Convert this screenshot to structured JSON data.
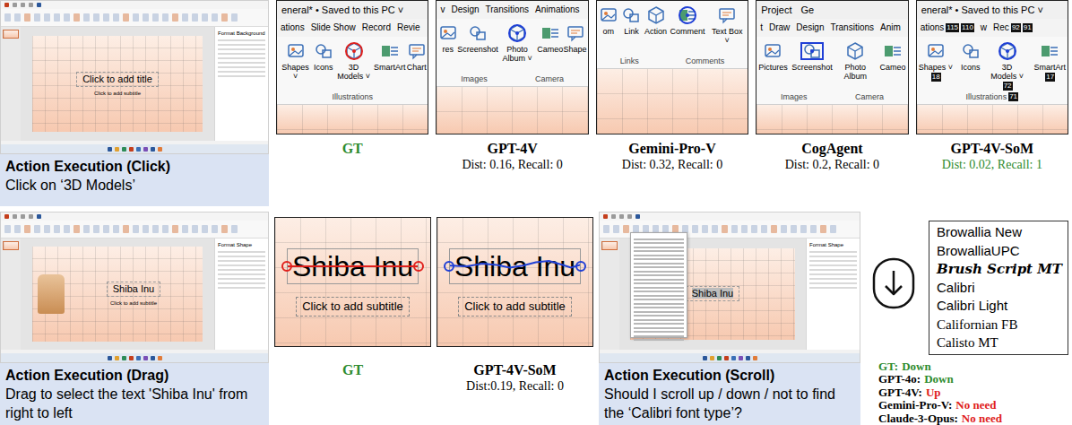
{
  "click_example": {
    "screenshot": {
      "slide_title": "Click to add title",
      "slide_subtitle": "Click to add subtitle",
      "pane_title": "Format Background"
    },
    "caption": {
      "title": "Action Execution (Click)",
      "instruction": "Click on ‘3D Models’"
    },
    "crops": [
      {
        "model": "GT",
        "reference": true,
        "titlebar": [
          "eneral* • Saved to this PC ˅"
        ],
        "tabs": [
          {
            "label": "ations",
            "tags": []
          },
          {
            "label": "Slide Show",
            "tags": []
          },
          {
            "label": "Record",
            "tags": []
          },
          {
            "label": "Revie",
            "tags": []
          }
        ],
        "items": [
          {
            "label": "Shapes ˅",
            "tags": [],
            "clicked": false
          },
          {
            "label": "Icons",
            "tags": [],
            "clicked": false
          },
          {
            "label": "3D Models ˅",
            "tags": [],
            "clicked": true
          },
          {
            "label": "SmartArt",
            "tags": [],
            "clicked": false
          },
          {
            "label": "Chart",
            "tags": [],
            "clicked": false
          }
        ],
        "groups": [
          {
            "label": "Illustrations",
            "tags": []
          }
        ],
        "marker": {
          "kind": "circle",
          "color": "#e0201c"
        }
      },
      {
        "model": "GPT-4V",
        "reference": false,
        "score": "Dist: 0.16, Recall: 0",
        "correct": false,
        "titlebar": [],
        "tabs": [
          {
            "label": "v",
            "tags": []
          },
          {
            "label": "Design",
            "tags": []
          },
          {
            "label": "Transitions",
            "tags": []
          },
          {
            "label": "Animations",
            "tags": []
          }
        ],
        "items": [
          {
            "label": "res",
            "tags": [],
            "clicked": false
          },
          {
            "label": "Screenshot",
            "tags": [],
            "clicked": false
          },
          {
            "label": "Photo Album ˅",
            "tags": [],
            "clicked": true
          },
          {
            "label": "Cameo",
            "tags": [],
            "clicked": false
          },
          {
            "label": "Shape",
            "tags": [],
            "clicked": false
          }
        ],
        "groups": [
          {
            "label": "Images",
            "tags": []
          },
          {
            "label": "Camera",
            "tags": []
          }
        ],
        "marker": {
          "kind": "circle",
          "color": "#1f3fd6"
        }
      },
      {
        "model": "Gemini-Pro-V",
        "reference": false,
        "score": "Dist: 0.32, Recall: 0",
        "correct": false,
        "titlebar": [],
        "tabs": [],
        "items": [
          {
            "label": "om",
            "tags": [],
            "clicked": false
          },
          {
            "label": "Link",
            "tags": [],
            "clicked": false
          },
          {
            "label": "Action",
            "tags": [],
            "clicked": false
          },
          {
            "label": "Comment",
            "tags": [],
            "clicked": true
          },
          {
            "label": "Text Box ˅",
            "tags": [],
            "clicked": false
          }
        ],
        "groups": [
          {
            "label": "Links",
            "tags": []
          },
          {
            "label": "Comments",
            "tags": []
          }
        ],
        "marker": {
          "kind": "circle",
          "color": "#1f3fd6"
        }
      },
      {
        "model": "CogAgent",
        "reference": false,
        "score": "Dist: 0.2, Recall: 0",
        "correct": false,
        "titlebar": [
          "Project",
          "Ge"
        ],
        "tabs": [
          {
            "label": "t",
            "tags": []
          },
          {
            "label": "Draw",
            "tags": []
          },
          {
            "label": "Design",
            "tags": []
          },
          {
            "label": "Transitions",
            "tags": []
          },
          {
            "label": "Anim",
            "tags": []
          }
        ],
        "items": [
          {
            "label": "Pictures",
            "tags": [],
            "clicked": false
          },
          {
            "label": "Screenshot",
            "tags": [],
            "clicked": true
          },
          {
            "label": "Photo Album",
            "tags": [],
            "clicked": false
          },
          {
            "label": "Cameo",
            "tags": [],
            "clicked": false
          }
        ],
        "groups": [
          {
            "label": "Images",
            "tags": []
          },
          {
            "label": "Camera",
            "tags": []
          }
        ],
        "marker": {
          "kind": "square",
          "color": "#1f3fd6"
        }
      },
      {
        "model": "GPT-4V-SoM",
        "reference": false,
        "score": "Dist: 0.02, Recall: 1",
        "correct": true,
        "titlebar": [
          "eneral* • Saved to this PC ˅"
        ],
        "tabs": [
          {
            "label": "ations",
            "tags": [
              "115",
              "110"
            ]
          },
          {
            "label": "w",
            "tags": []
          },
          {
            "label": "Rec",
            "tags": [
              "92",
              "91"
            ]
          }
        ],
        "items": [
          {
            "label": "Shapes ˅",
            "tags": [
              "18"
            ],
            "clicked": false
          },
          {
            "label": "Icons",
            "tags": [],
            "clicked": false
          },
          {
            "label": "3D Models ˅",
            "tags": [
              "72"
            ],
            "clicked": true
          },
          {
            "label": "SmartArt",
            "tags": [
              "17"
            ],
            "clicked": false
          }
        ],
        "groups": [
          {
            "label": "Illustrations",
            "tags": [
              "71"
            ]
          }
        ],
        "marker": {
          "kind": "circle",
          "color": "#1f3fd6"
        }
      }
    ]
  },
  "drag_example": {
    "screenshot": {
      "slide_title": "Shiba Inu",
      "slide_subtitle": "Click to add subtitle",
      "pane_title": "Format Shape"
    },
    "caption": {
      "title": "Action Execution (Drag)",
      "instruction": "Drag to select the text 'Shiba Inu' from right to left"
    },
    "crops": [
      {
        "model": "GT",
        "reference": true,
        "title_text": "Shiba Inu",
        "subtitle_text": "Click to add subtitle",
        "trace": {
          "kind": "straight",
          "color": "#e0201c"
        }
      },
      {
        "model": "GPT-4V-SoM",
        "reference": false,
        "score": "Dist:0.19, Recall: 0",
        "correct": false,
        "title_text": "Shiba Inu",
        "subtitle_text": "Click to add subtitle",
        "trace": {
          "kind": "wavy",
          "color": "#1f3fd6"
        }
      }
    ]
  },
  "scroll_example": {
    "screenshot": {
      "slide_title": "Shiba Inu",
      "highlighted": true,
      "pane_title": "Format Shape"
    },
    "caption": {
      "title": "Action Execution (Scroll)",
      "instruction": "Should I scroll up / down / not to find the ‘Calibri font type’?"
    },
    "fonts": [
      {
        "label": "Browallia New",
        "kind": "sans"
      },
      {
        "label": "BrowalliaUPC",
        "kind": "sans"
      },
      {
        "label": "Brush Script MT",
        "kind": "script"
      },
      {
        "label": "Calibri",
        "kind": "sans"
      },
      {
        "label": "Calibri Light",
        "kind": "sans"
      },
      {
        "label": "Californian FB",
        "kind": "serif"
      },
      {
        "label": "Calisto MT",
        "kind": "serif"
      }
    ],
    "answers": [
      {
        "model": "GT:",
        "answer": "Down",
        "reference": true,
        "correct": true
      },
      {
        "model": "GPT-4o:",
        "answer": "Down",
        "reference": false,
        "correct": true
      },
      {
        "model": "GPT-4V:",
        "answer": "Up",
        "reference": false,
        "correct": false
      },
      {
        "model": "Gemini-Pro-V:",
        "answer": "No need",
        "reference": false,
        "correct": false
      },
      {
        "model": "Claude-3-Opus:",
        "answer": "No need",
        "reference": false,
        "correct": false
      }
    ]
  }
}
